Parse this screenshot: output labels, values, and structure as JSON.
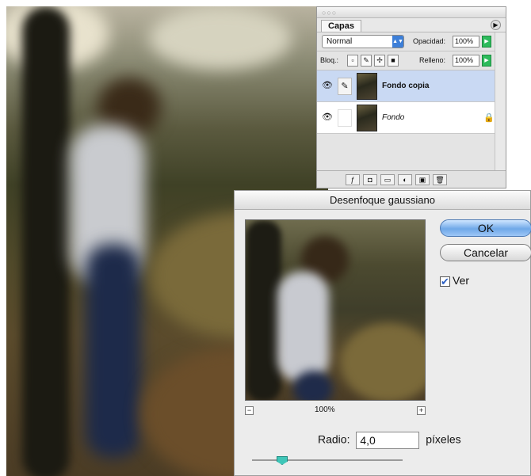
{
  "layers_panel": {
    "tab_label": "Capas",
    "blend_mode": "Normal",
    "opacity_label": "Opacidad:",
    "opacity_value": "100%",
    "lock_label": "Bloq.:",
    "fill_label": "Relleno:",
    "fill_value": "100%",
    "layers": [
      {
        "name": "Fondo copia",
        "selected": true,
        "locked": false
      },
      {
        "name": "Fondo",
        "selected": false,
        "locked": true
      }
    ]
  },
  "dialog": {
    "title": "Desenfoque gaussiano",
    "ok_label": "OK",
    "cancel_label": "Cancelar",
    "preview_label": "Ver",
    "preview_checked": true,
    "zoom_value": "100%",
    "radius_label": "Radio:",
    "radius_value": "4,0",
    "radius_unit": "píxeles",
    "radius_slider_fraction": 0.2
  },
  "icons": {
    "eye": "eye-icon",
    "brush": "brush-icon",
    "lock": "lock-icon",
    "menu": "panel-menu-arrow-icon"
  }
}
